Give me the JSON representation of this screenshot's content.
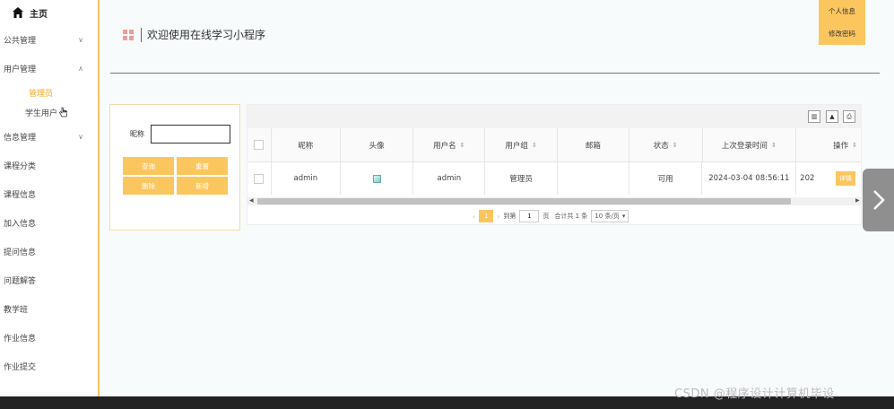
{
  "sidebar": {
    "home": "主页",
    "items": [
      {
        "label": "公共管理",
        "chevron": "∨"
      },
      {
        "label": "用户管理",
        "chevron": "∧"
      },
      {
        "label": "信息管理",
        "chevron": "∨"
      },
      {
        "label": "课程分类"
      },
      {
        "label": "课程信息"
      },
      {
        "label": "加入信息"
      },
      {
        "label": "提问信息"
      },
      {
        "label": "问题解答"
      },
      {
        "label": "教学班"
      },
      {
        "label": "作业信息"
      },
      {
        "label": "作业提交"
      }
    ],
    "sub_items": [
      {
        "label": "管理员",
        "active": true
      },
      {
        "label": "学生用户",
        "active": false
      }
    ]
  },
  "header": {
    "title": "欢迎使用在线学习小程序"
  },
  "top_buttons": {
    "profile": "个人信息",
    "change_password": "修改密码"
  },
  "search": {
    "label": "昵称",
    "value": "",
    "buttons": {
      "query": "查询",
      "reset": "重置",
      "delete": "删除",
      "add": "新增"
    }
  },
  "toolbar_icons": [
    "columns-icon",
    "export-icon",
    "print-icon"
  ],
  "table": {
    "columns": [
      {
        "label": "昵称",
        "sortable": false
      },
      {
        "label": "头像",
        "sortable": false
      },
      {
        "label": "用户名",
        "sortable": true
      },
      {
        "label": "用户组",
        "sortable": true
      },
      {
        "label": "邮箱",
        "sortable": false
      },
      {
        "label": "状态",
        "sortable": true
      },
      {
        "label": "上次登录时间",
        "sortable": true
      },
      {
        "label": "操作",
        "sortable": true
      }
    ],
    "rows": [
      {
        "nickname": "admin",
        "avatar": "",
        "username": "admin",
        "group": "管理员",
        "email": "",
        "status": "可用",
        "last_login": "2024-03-04 08:56:11",
        "extra": "202",
        "action": "详情"
      }
    ]
  },
  "pagination": {
    "current_page": "1",
    "goto_label": "到第",
    "goto_value": "1",
    "page_unit": "页",
    "total": "合计共 1 条",
    "page_size": "10 条/页"
  },
  "watermark": "CSDN @程序设计计算机毕设",
  "colors": {
    "accent": "#fcc65f",
    "active_text": "#f5a623"
  }
}
